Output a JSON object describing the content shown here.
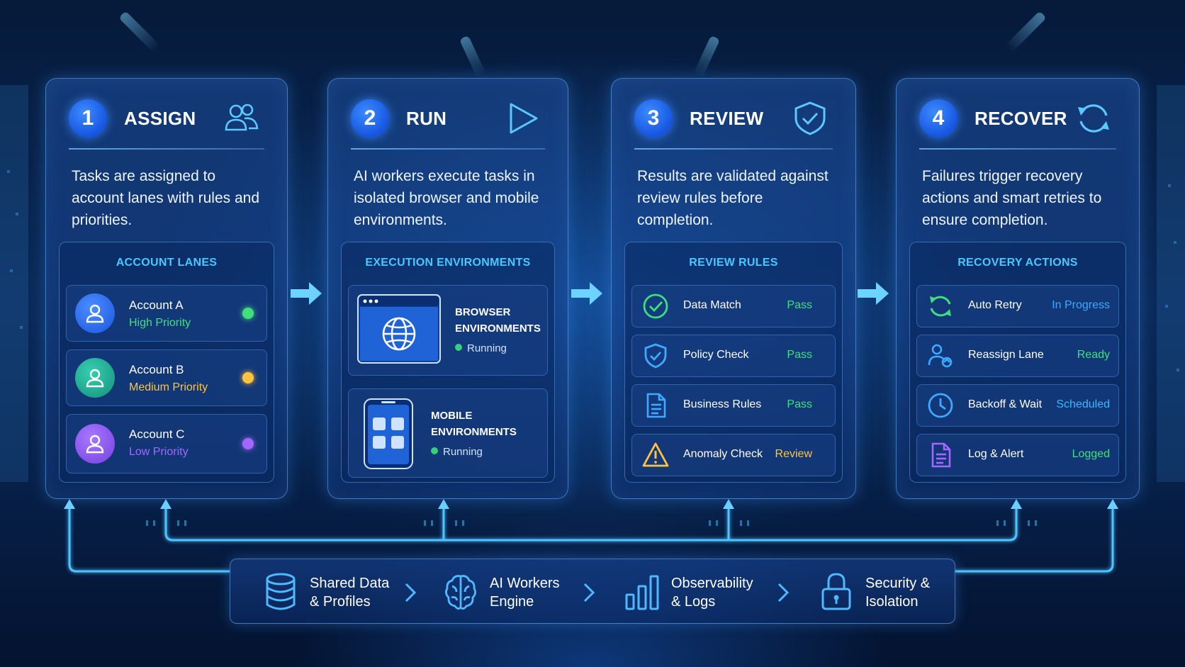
{
  "steps": [
    {
      "number": "1",
      "title": "ASSIGN",
      "icon": "users-icon",
      "description": "Tasks are assigned to account lanes with rules and priorities.",
      "panel_title": "ACCOUNT LANES",
      "accounts": [
        {
          "name": "Account A",
          "priority": "High Priority",
          "color": "#3fe07c",
          "avatar_color": "#2a73ff"
        },
        {
          "name": "Account B",
          "priority": "Medium Priority",
          "color": "#ffc43d",
          "avatar_color": "#1fb39a"
        },
        {
          "name": "Account C",
          "priority": "Low Priority",
          "color": "#a267ff",
          "avatar_color": "#8a52f0"
        }
      ]
    },
    {
      "number": "2",
      "title": "RUN",
      "icon": "play-icon",
      "description": "AI workers execute tasks in isolated browser and mobile environments.",
      "panel_title": "EXECUTION ENVIRONMENTS",
      "environments": [
        {
          "title_line1": "BROWSER",
          "title_line2": "ENVIRONMENTS",
          "status": "Running",
          "icon": "globe-icon"
        },
        {
          "title_line1": "MOBILE",
          "title_line2": "ENVIRONMENTS",
          "status": "Running",
          "icon": "phone-icon"
        }
      ]
    },
    {
      "number": "3",
      "title": "REVIEW",
      "icon": "shield-check-icon",
      "description": "Results are validated against review rules before completion.",
      "panel_title": "REVIEW RULES",
      "rules": [
        {
          "name": "Data Match",
          "status": "Pass",
          "status_color": "#3fe07c",
          "icon": "check-circle-icon"
        },
        {
          "name": "Policy Check",
          "status": "Pass",
          "status_color": "#3fe07c",
          "icon": "shield-icon"
        },
        {
          "name": "Business Rules",
          "status": "Pass",
          "status_color": "#3fe07c",
          "icon": "document-icon"
        },
        {
          "name": "Anomaly Check",
          "status": "Review",
          "status_color": "#ffc43d",
          "icon": "warning-icon"
        }
      ]
    },
    {
      "number": "4",
      "title": "RECOVER",
      "icon": "refresh-icon",
      "description": "Failures trigger recovery actions and smart retries to ensure completion.",
      "panel_title": "RECOVERY ACTIONS",
      "actions": [
        {
          "name": "Auto Retry",
          "status": "In Progress",
          "status_color": "#3fa9ff",
          "icon": "retry-icon"
        },
        {
          "name": "Reassign Lane",
          "status": "Ready",
          "status_color": "#3fe07c",
          "icon": "reassign-user-icon"
        },
        {
          "name": "Backoff & Wait",
          "status": "Scheduled",
          "status_color": "#3fb7ff",
          "icon": "clock-icon"
        },
        {
          "name": "Log & Alert",
          "status": "Logged",
          "status_color": "#3fe07c",
          "icon": "log-file-icon"
        }
      ]
    }
  ],
  "bottom_bar": [
    {
      "line1": "Shared Data",
      "line2": "& Profiles",
      "icon": "database-icon"
    },
    {
      "line1": "AI Workers",
      "line2": "Engine",
      "icon": "brain-icon"
    },
    {
      "line1": "Observability",
      "line2": "& Logs",
      "icon": "bar-chart-icon"
    },
    {
      "line1": "Security &",
      "line2": "Isolation",
      "icon": "lock-icon"
    }
  ],
  "colors": {
    "accent": "#48c8ff",
    "step_badge": "#1f66f0",
    "flow_line": "#4fc3ff"
  }
}
